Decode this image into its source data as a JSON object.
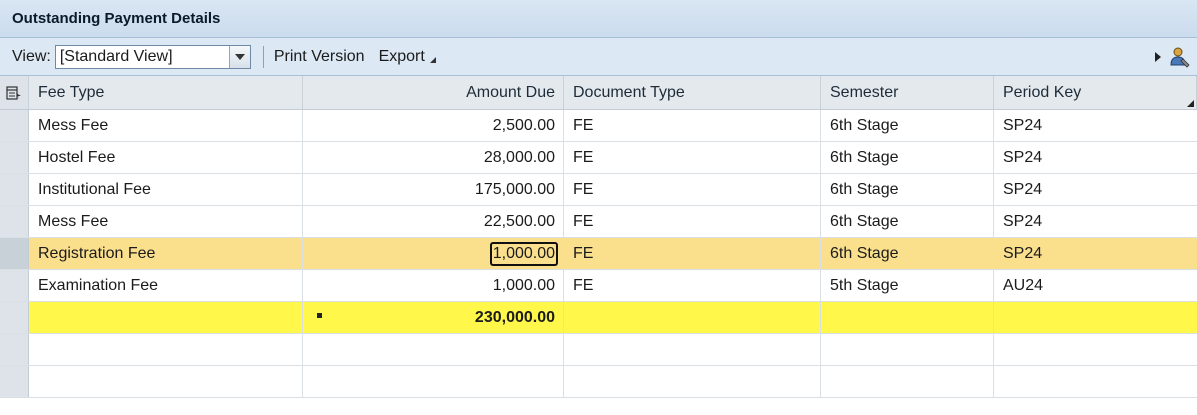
{
  "window": {
    "title": "Outstanding Payment Details"
  },
  "toolbar": {
    "view_label": "View:",
    "view_selected": "[Standard View]",
    "print_label": "Print Version",
    "export_label": "Export"
  },
  "table": {
    "columns": [
      "Fee Type",
      "Amount Due",
      "Document Type",
      "Semester",
      "Period Key"
    ],
    "rows": [
      {
        "fee_type": "Mess Fee",
        "amount_due": "2,500.00",
        "document_type": "FE",
        "semester": "6th Stage",
        "period_key": "SP24"
      },
      {
        "fee_type": "Hostel Fee",
        "amount_due": "28,000.00",
        "document_type": "FE",
        "semester": "6th Stage",
        "period_key": "SP24"
      },
      {
        "fee_type": "Institutional Fee",
        "amount_due": "175,000.00",
        "document_type": "FE",
        "semester": "6th Stage",
        "period_key": "SP24"
      },
      {
        "fee_type": "Mess Fee",
        "amount_due": "22,500.00",
        "document_type": "FE",
        "semester": "6th Stage",
        "period_key": "SP24"
      },
      {
        "fee_type": "Registration Fee",
        "amount_due": "1,000.00",
        "document_type": "FE",
        "semester": "6th Stage",
        "period_key": "SP24"
      },
      {
        "fee_type": "Examination Fee",
        "amount_due": "1,000.00",
        "document_type": "FE",
        "semester": "5th Stage",
        "period_key": "AU24"
      }
    ],
    "total_amount": "230,000.00"
  },
  "colors": {
    "selected_row": "#fadf8d",
    "total_row": "#fff84a",
    "header_bg": "#dce8f4"
  },
  "icons": [
    "dropdown-arrow-icon",
    "export-arrow-icon",
    "expand-right-icon",
    "personalize-user-icon",
    "column-settings-icon",
    "sort-indicator-icon"
  ]
}
